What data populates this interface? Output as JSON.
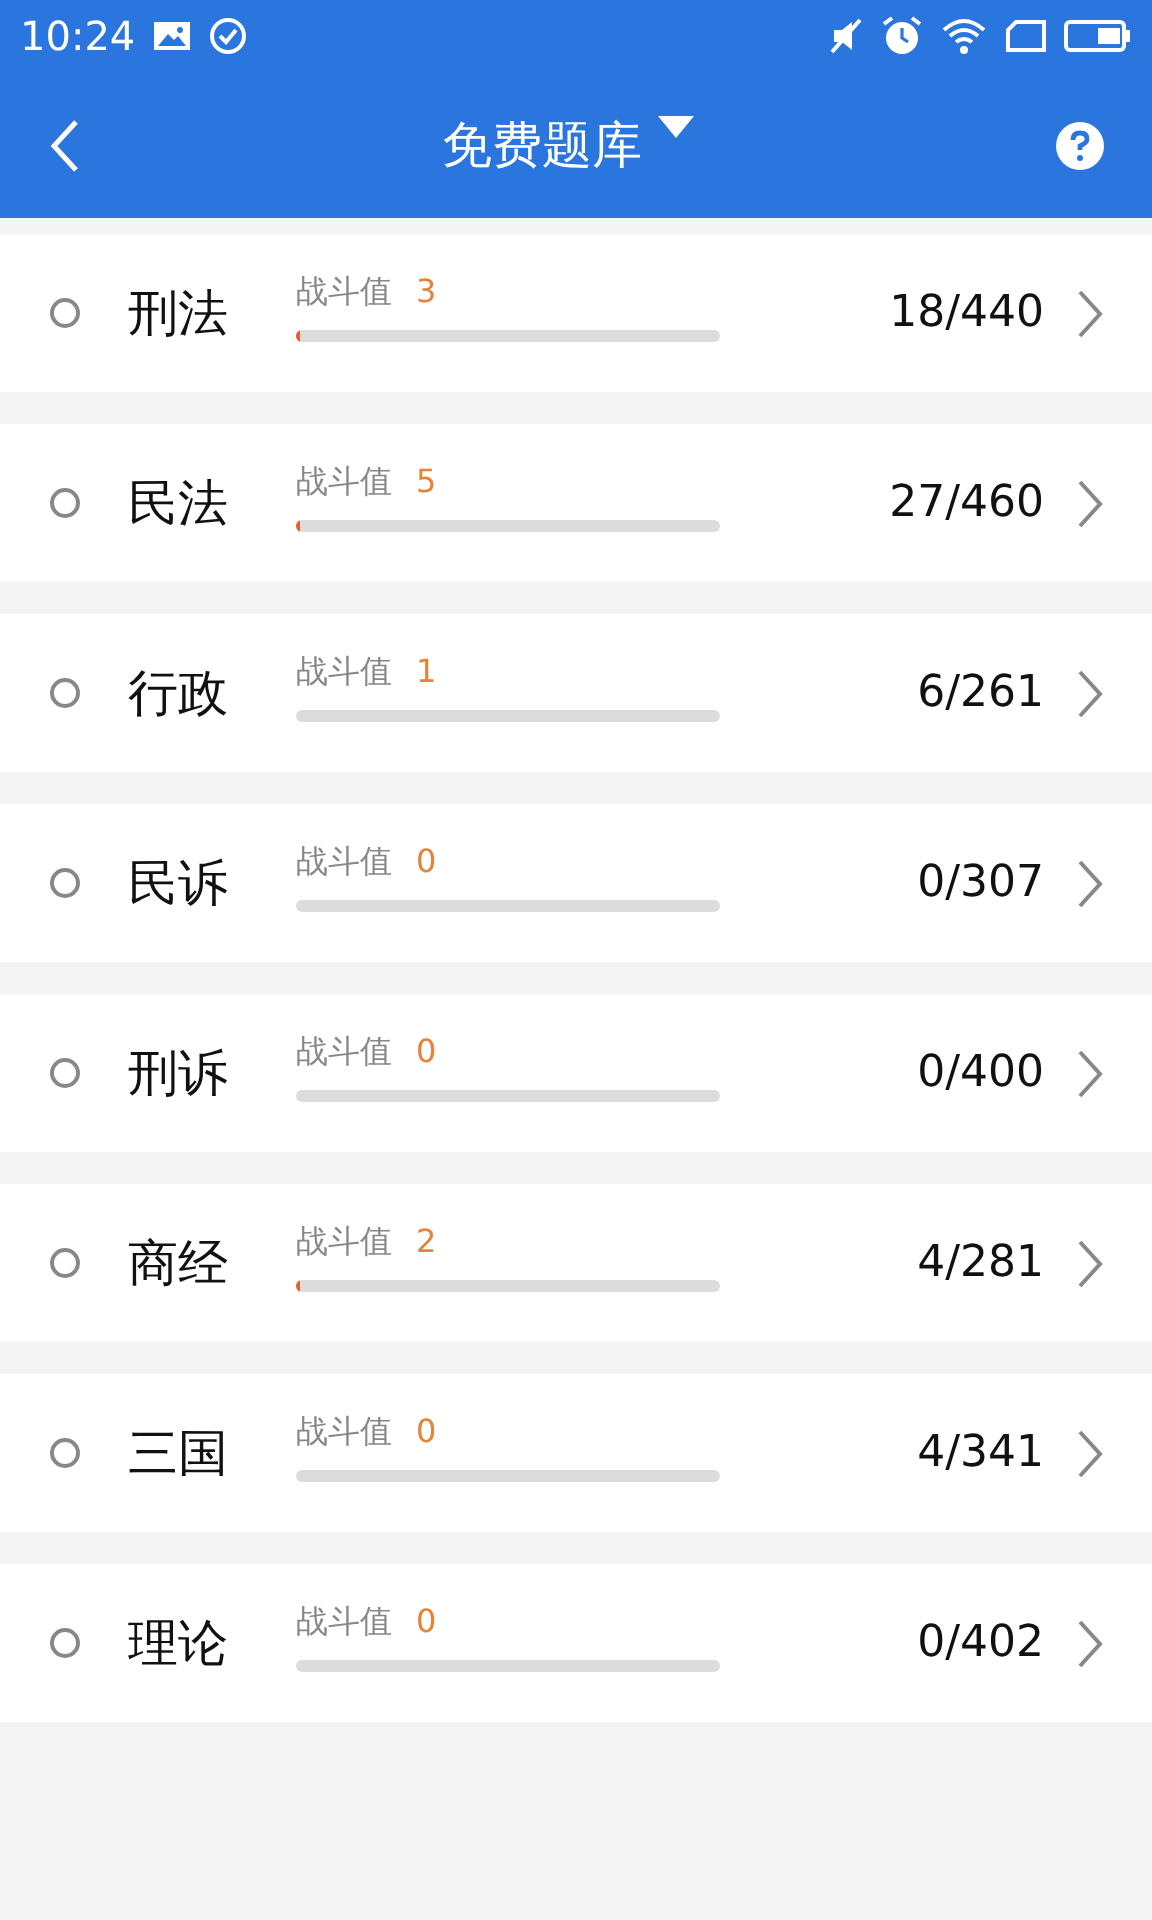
{
  "status_bar": {
    "time": "10:24"
  },
  "header": {
    "title": "免费题库"
  },
  "subjects": [
    {
      "name": "刑法",
      "label": "战斗值",
      "score": "3",
      "level": 0.01,
      "progress": "18/440"
    },
    {
      "name": "民法",
      "label": "战斗值",
      "score": "5",
      "level": 0.01,
      "progress": "27/460"
    },
    {
      "name": "行政",
      "label": "战斗值",
      "score": "1",
      "level": 0,
      "progress": "6/261"
    },
    {
      "name": "民诉",
      "label": "战斗值",
      "score": "0",
      "level": 0,
      "progress": "0/307"
    },
    {
      "name": "刑诉",
      "label": "战斗值",
      "score": "0",
      "level": 0,
      "progress": "0/400"
    },
    {
      "name": "商经",
      "label": "战斗值",
      "score": "2",
      "level": 0.01,
      "progress": "4/281"
    },
    {
      "name": "三国",
      "label": "战斗值",
      "score": "0",
      "level": 0,
      "progress": "4/341"
    },
    {
      "name": "理论",
      "label": "战斗值",
      "score": "0",
      "level": 0,
      "progress": "0/402"
    }
  ]
}
